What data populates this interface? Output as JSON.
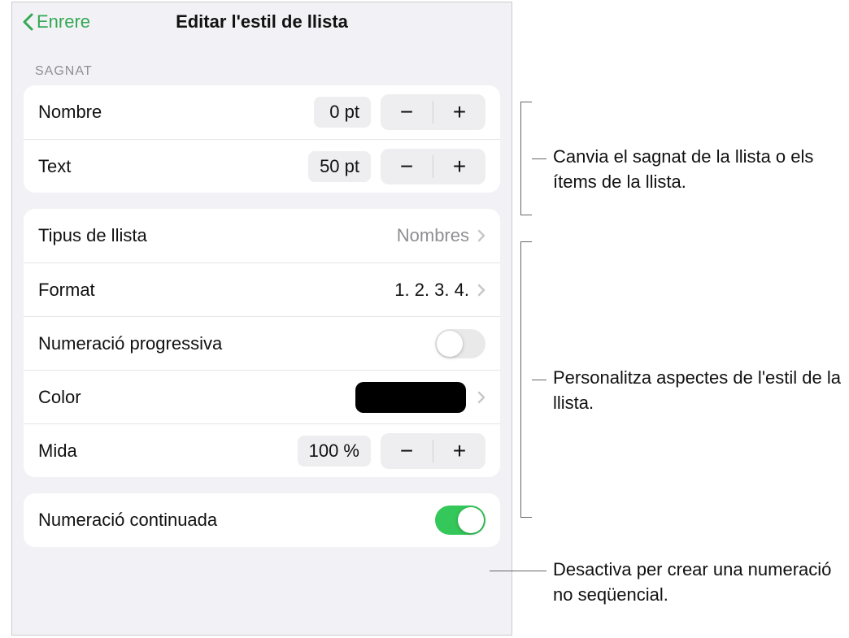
{
  "header": {
    "back_label": "Enrere",
    "title": "Editar l'estil de llista"
  },
  "sections": {
    "indent": {
      "header": "Sagnat",
      "number_label": "Nombre",
      "number_value": "0 pt",
      "text_label": "Text",
      "text_value": "50 pt"
    },
    "style": {
      "list_type_label": "Tipus de llista",
      "list_type_value": "Nombres",
      "format_label": "Format",
      "format_value": "1. 2. 3. 4.",
      "progressive_label": "Numeració progressiva",
      "progressive_on": false,
      "color_label": "Color",
      "color_value": "#000000",
      "size_label": "Mida",
      "size_value": "100 %"
    },
    "continued": {
      "label": "Numeració continuada",
      "on": true
    }
  },
  "callouts": {
    "c1": "Canvia el sagnat de la llista o els ítems de la llista.",
    "c2": "Personalitza aspectes de l'estil de la llista.",
    "c3": "Desactiva per crear una numeració no seqüencial."
  },
  "glyphs": {
    "minus": "−",
    "plus": "+"
  }
}
